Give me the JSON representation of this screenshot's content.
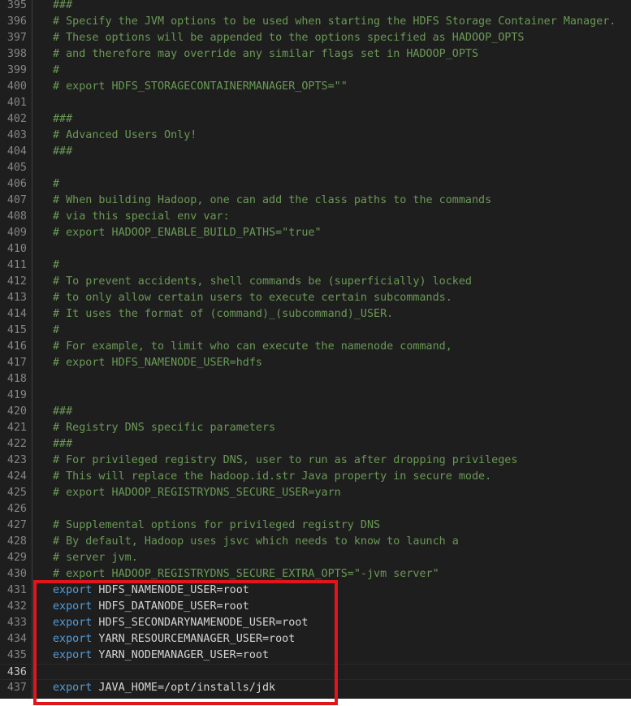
{
  "colors": {
    "background": "#1e1e1e",
    "comment": "#6a9955",
    "keyword": "#569cd6",
    "text": "#d4d4d4",
    "line_number": "#858585",
    "highlight_border": "#e0161c"
  },
  "lines": [
    {
      "n": "395",
      "tokens": [
        {
          "t": "###",
          "c": "comment"
        }
      ]
    },
    {
      "n": "396",
      "tokens": [
        {
          "t": "# Specify the JVM options to be used when starting the HDFS Storage Container Manager.",
          "c": "comment"
        }
      ]
    },
    {
      "n": "397",
      "tokens": [
        {
          "t": "# These options will be appended to the options specified as HADOOP_OPTS",
          "c": "comment"
        }
      ]
    },
    {
      "n": "398",
      "tokens": [
        {
          "t": "# and therefore may override any similar flags set in HADOOP_OPTS",
          "c": "comment"
        }
      ]
    },
    {
      "n": "399",
      "tokens": [
        {
          "t": "#",
          "c": "comment"
        }
      ]
    },
    {
      "n": "400",
      "tokens": [
        {
          "t": "# export HDFS_STORAGECONTAINERMANAGER_OPTS=\"\"",
          "c": "comment"
        }
      ]
    },
    {
      "n": "401",
      "tokens": []
    },
    {
      "n": "402",
      "tokens": [
        {
          "t": "###",
          "c": "comment"
        }
      ]
    },
    {
      "n": "403",
      "tokens": [
        {
          "t": "# Advanced Users Only!",
          "c": "comment"
        }
      ]
    },
    {
      "n": "404",
      "tokens": [
        {
          "t": "###",
          "c": "comment"
        }
      ]
    },
    {
      "n": "405",
      "tokens": []
    },
    {
      "n": "406",
      "tokens": [
        {
          "t": "#",
          "c": "comment"
        }
      ]
    },
    {
      "n": "407",
      "tokens": [
        {
          "t": "# When building Hadoop, one can add the class paths to the commands",
          "c": "comment"
        }
      ]
    },
    {
      "n": "408",
      "tokens": [
        {
          "t": "# via this special env var:",
          "c": "comment"
        }
      ]
    },
    {
      "n": "409",
      "tokens": [
        {
          "t": "# export HADOOP_ENABLE_BUILD_PATHS=\"true\"",
          "c": "comment"
        }
      ]
    },
    {
      "n": "410",
      "tokens": []
    },
    {
      "n": "411",
      "tokens": [
        {
          "t": "#",
          "c": "comment"
        }
      ]
    },
    {
      "n": "412",
      "tokens": [
        {
          "t": "# To prevent accidents, shell commands be (superficially) locked",
          "c": "comment"
        }
      ]
    },
    {
      "n": "413",
      "tokens": [
        {
          "t": "# to only allow certain users to execute certain subcommands.",
          "c": "comment"
        }
      ]
    },
    {
      "n": "414",
      "tokens": [
        {
          "t": "# It uses the format of (command)_(subcommand)_USER.",
          "c": "comment"
        }
      ]
    },
    {
      "n": "415",
      "tokens": [
        {
          "t": "#",
          "c": "comment"
        }
      ]
    },
    {
      "n": "416",
      "tokens": [
        {
          "t": "# For example, to limit who can execute the namenode command,",
          "c": "comment"
        }
      ]
    },
    {
      "n": "417",
      "tokens": [
        {
          "t": "# export HDFS_NAMENODE_USER=hdfs",
          "c": "comment"
        }
      ]
    },
    {
      "n": "418",
      "tokens": []
    },
    {
      "n": "419",
      "tokens": []
    },
    {
      "n": "420",
      "tokens": [
        {
          "t": "###",
          "c": "comment"
        }
      ]
    },
    {
      "n": "421",
      "tokens": [
        {
          "t": "# Registry DNS specific parameters",
          "c": "comment"
        }
      ]
    },
    {
      "n": "422",
      "tokens": [
        {
          "t": "###",
          "c": "comment"
        }
      ]
    },
    {
      "n": "423",
      "tokens": [
        {
          "t": "# For privileged registry DNS, user to run as after dropping privileges",
          "c": "comment"
        }
      ]
    },
    {
      "n": "424",
      "tokens": [
        {
          "t": "# This will replace the hadoop.id.str Java property in secure mode.",
          "c": "comment"
        }
      ]
    },
    {
      "n": "425",
      "tokens": [
        {
          "t": "# export HADOOP_REGISTRYDNS_SECURE_USER=yarn",
          "c": "comment"
        }
      ]
    },
    {
      "n": "426",
      "tokens": []
    },
    {
      "n": "427",
      "tokens": [
        {
          "t": "# Supplemental options for privileged registry DNS",
          "c": "comment"
        }
      ]
    },
    {
      "n": "428",
      "tokens": [
        {
          "t": "# By default, Hadoop uses jsvc which needs to know to launch a",
          "c": "comment"
        }
      ]
    },
    {
      "n": "429",
      "tokens": [
        {
          "t": "# server jvm.",
          "c": "comment"
        }
      ]
    },
    {
      "n": "430",
      "tokens": [
        {
          "t": "# export HADOOP_REGISTRYDNS_SECURE_EXTRA_OPTS=\"-jvm server\"",
          "c": "comment"
        }
      ]
    },
    {
      "n": "431",
      "tokens": [
        {
          "t": "export",
          "c": "keyword"
        },
        {
          "t": " HDFS_NAMENODE_USER=root",
          "c": "text"
        }
      ]
    },
    {
      "n": "432",
      "tokens": [
        {
          "t": "export",
          "c": "keyword"
        },
        {
          "t": " HDFS_DATANODE_USER=root",
          "c": "text"
        }
      ]
    },
    {
      "n": "433",
      "tokens": [
        {
          "t": "export",
          "c": "keyword"
        },
        {
          "t": " HDFS_SECONDARYNAMENODE_USER=root",
          "c": "text"
        }
      ]
    },
    {
      "n": "434",
      "tokens": [
        {
          "t": "export",
          "c": "keyword"
        },
        {
          "t": " YARN_RESOURCEMANAGER_USER=root",
          "c": "text"
        }
      ]
    },
    {
      "n": "435",
      "tokens": [
        {
          "t": "export",
          "c": "keyword"
        },
        {
          "t": " YARN_NODEMANAGER_USER=root",
          "c": "text"
        }
      ]
    },
    {
      "n": "436",
      "tokens": [],
      "current": true
    },
    {
      "n": "437",
      "tokens": [
        {
          "t": "export",
          "c": "keyword"
        },
        {
          "t": " JAVA_HOME=/opt/installs/jdk",
          "c": "text"
        }
      ]
    }
  ]
}
